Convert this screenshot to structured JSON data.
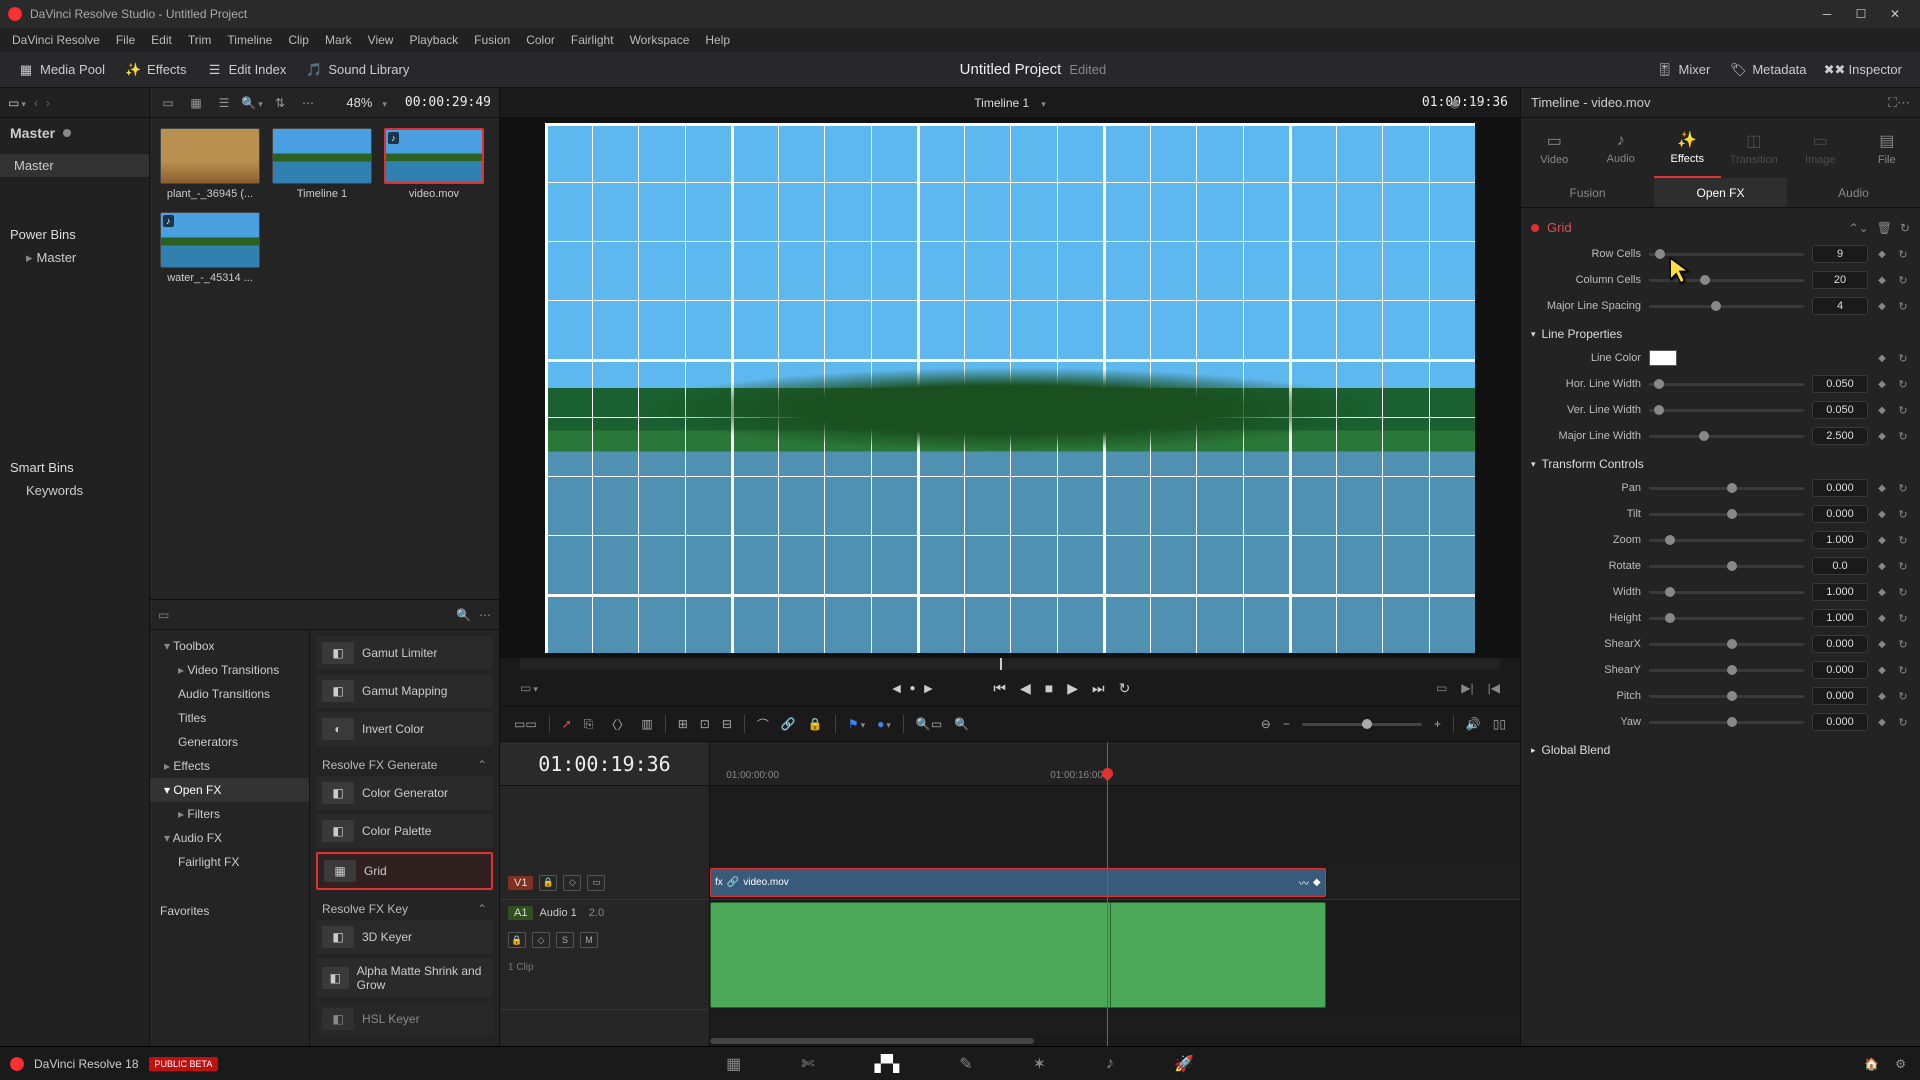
{
  "window": {
    "title": "DaVinci Resolve Studio - Untitled Project"
  },
  "menubar": [
    "DaVinci Resolve",
    "File",
    "Edit",
    "Trim",
    "Timeline",
    "Clip",
    "Mark",
    "View",
    "Playback",
    "Fusion",
    "Color",
    "Fairlight",
    "Workspace",
    "Help"
  ],
  "toolbar": {
    "media_pool": "Media Pool",
    "effects": "Effects",
    "edit_index": "Edit Index",
    "sound_library": "Sound Library",
    "project": "Untitled Project",
    "edited": "Edited",
    "mixer": "Mixer",
    "metadata": "Metadata",
    "inspector": "Inspector"
  },
  "left": {
    "master": "Master",
    "master_node": "Master",
    "power_bins": "Power Bins",
    "power_master": "Master",
    "smart_bins": "Smart Bins",
    "keywords": "Keywords",
    "favorites": "Favorites"
  },
  "media_top": {
    "pct": "48%",
    "tc": "00:00:29:49"
  },
  "clips": [
    {
      "name": "plant_-_36945 (...",
      "scene": "scene-field",
      "badge": ""
    },
    {
      "name": "Timeline 1",
      "scene": "scene-island",
      "badge": ""
    },
    {
      "name": "video.mov",
      "scene": "scene-island",
      "badge": "♪",
      "selected": true
    },
    {
      "name": "water_-_45314 ...",
      "scene": "scene-island",
      "badge": "♪"
    }
  ],
  "fx_tree": {
    "toolbox": "Toolbox",
    "video_transitions": "Video Transitions",
    "audio_transitions": "Audio Transitions",
    "titles": "Titles",
    "generators": "Generators",
    "effects": "Effects",
    "open_fx": "Open FX",
    "filters": "Filters",
    "audio_fx": "Audio FX",
    "fairlight_fx": "Fairlight FX"
  },
  "fx_groups": {
    "color_top": [
      "Gamut Limiter",
      "Gamut Mapping",
      "Invert Color"
    ],
    "generate_title": "Resolve FX Generate",
    "generate": [
      "Color Generator",
      "Color Palette",
      "Grid"
    ],
    "key_title": "Resolve FX Key",
    "key": [
      "3D Keyer",
      "Alpha Matte Shrink and Grow",
      "HSL Keyer"
    ]
  },
  "viewer": {
    "timeline_name": "Timeline 1",
    "right_tc": "01:00:19:36"
  },
  "timeline": {
    "tc": "01:00:19:36",
    "ruler_ticks": [
      "01:00:00:00",
      "01:00:16:00"
    ],
    "v1": "V1",
    "a1": "A1",
    "audio_name": "Audio 1",
    "audio_ch": "2.0",
    "clip_count": "1 Clip",
    "clip_name": "video.mov",
    "playhead_pct": 49,
    "clip_start_pct": 0,
    "clip_end_pct": 76,
    "audio_divider_pct": 49
  },
  "inspector": {
    "title": "Timeline - video.mov",
    "tabs": [
      "Video",
      "Audio",
      "Effects",
      "Transition",
      "Image",
      "File"
    ],
    "subtabs": [
      "Fusion",
      "Open FX",
      "Audio"
    ],
    "fx_name": "Grid",
    "grid_params": {
      "row_cells": {
        "label": "Row Cells",
        "value": "9",
        "knob": 4
      },
      "col_cells": {
        "label": "Column Cells",
        "value": "20",
        "knob": 33
      },
      "major_spacing": {
        "label": "Major Line Spacing",
        "value": "4",
        "knob": 40
      }
    },
    "line_props_title": "Line Properties",
    "line_props": {
      "line_color": {
        "label": "Line Color"
      },
      "hor_width": {
        "label": "Hor. Line Width",
        "value": "0.050",
        "knob": 3
      },
      "ver_width": {
        "label": "Ver. Line Width",
        "value": "0.050",
        "knob": 3
      },
      "major_width": {
        "label": "Major Line Width",
        "value": "2.500",
        "knob": 32
      }
    },
    "transform_title": "Transform Controls",
    "transform": [
      {
        "label": "Pan",
        "value": "0.000",
        "knob": 50
      },
      {
        "label": "Tilt",
        "value": "0.000",
        "knob": 50
      },
      {
        "label": "Zoom",
        "value": "1.000",
        "knob": 10
      },
      {
        "label": "Rotate",
        "value": "0.0",
        "knob": 50
      },
      {
        "label": "Width",
        "value": "1.000",
        "knob": 10
      },
      {
        "label": "Height",
        "value": "1.000",
        "knob": 10
      },
      {
        "label": "ShearX",
        "value": "0.000",
        "knob": 50
      },
      {
        "label": "ShearY",
        "value": "0.000",
        "knob": 50
      },
      {
        "label": "Pitch",
        "value": "0.000",
        "knob": 50
      },
      {
        "label": "Yaw",
        "value": "0.000",
        "knob": 50
      }
    ],
    "global_blend": "Global Blend"
  },
  "pagebar": {
    "app": "DaVinci Resolve 18",
    "beta": "PUBLIC BETA"
  }
}
